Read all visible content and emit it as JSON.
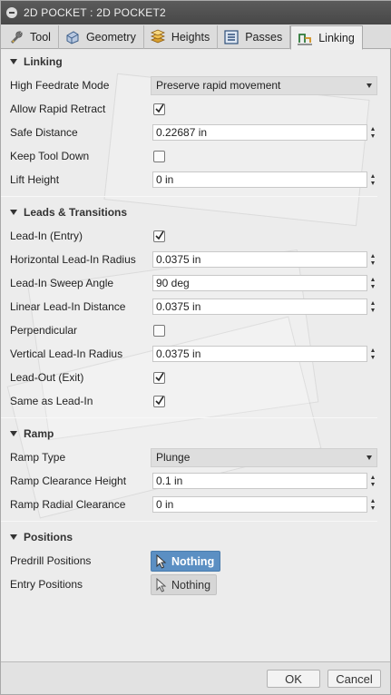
{
  "window": {
    "title": "2D POCKET : 2D POCKET2"
  },
  "tabs": [
    {
      "label": "Tool",
      "icon": "tool-icon"
    },
    {
      "label": "Geometry",
      "icon": "geometry-icon"
    },
    {
      "label": "Heights",
      "icon": "heights-icon"
    },
    {
      "label": "Passes",
      "icon": "passes-icon"
    },
    {
      "label": "Linking",
      "icon": "linking-icon",
      "active": true
    }
  ],
  "linking": {
    "title": "Linking",
    "high_feedrate_mode": {
      "label": "High Feedrate Mode",
      "value": "Preserve rapid movement"
    },
    "allow_rapid_retract": {
      "label": "Allow Rapid Retract",
      "checked": true
    },
    "safe_distance": {
      "label": "Safe Distance",
      "value": "0.22687 in"
    },
    "keep_tool_down": {
      "label": "Keep Tool Down",
      "checked": false
    },
    "lift_height": {
      "label": "Lift Height",
      "value": "0 in"
    }
  },
  "leads": {
    "title": "Leads & Transitions",
    "lead_in": {
      "label": "Lead-In (Entry)",
      "checked": true
    },
    "horizontal_lead_in_radius": {
      "label": "Horizontal Lead-In Radius",
      "value": "0.0375 in"
    },
    "lead_in_sweep_angle": {
      "label": "Lead-In Sweep Angle",
      "value": "90 deg"
    },
    "linear_lead_in_distance": {
      "label": "Linear Lead-In Distance",
      "value": "0.0375 in"
    },
    "perpendicular": {
      "label": "Perpendicular",
      "checked": false
    },
    "vertical_lead_in_radius": {
      "label": "Vertical Lead-In Radius",
      "value": "0.0375 in"
    },
    "lead_out": {
      "label": "Lead-Out (Exit)",
      "checked": true
    },
    "same_as_lead_in": {
      "label": "Same as Lead-In",
      "checked": true
    }
  },
  "ramp": {
    "title": "Ramp",
    "ramp_type": {
      "label": "Ramp Type",
      "value": "Plunge"
    },
    "ramp_clearance_height": {
      "label": "Ramp Clearance Height",
      "value": "0.1 in"
    },
    "ramp_radial_clearance": {
      "label": "Ramp Radial Clearance",
      "value": "0 in"
    }
  },
  "positions": {
    "title": "Positions",
    "predrill": {
      "label": "Predrill Positions",
      "button": "Nothing"
    },
    "entry": {
      "label": "Entry Positions",
      "button": "Nothing"
    }
  },
  "footer": {
    "ok_label": "OK",
    "cancel_label": "Cancel"
  },
  "colors": {
    "titlebar": "#4f4f4f",
    "selection_active": "#5b8fc3",
    "panel": "#ececec"
  }
}
